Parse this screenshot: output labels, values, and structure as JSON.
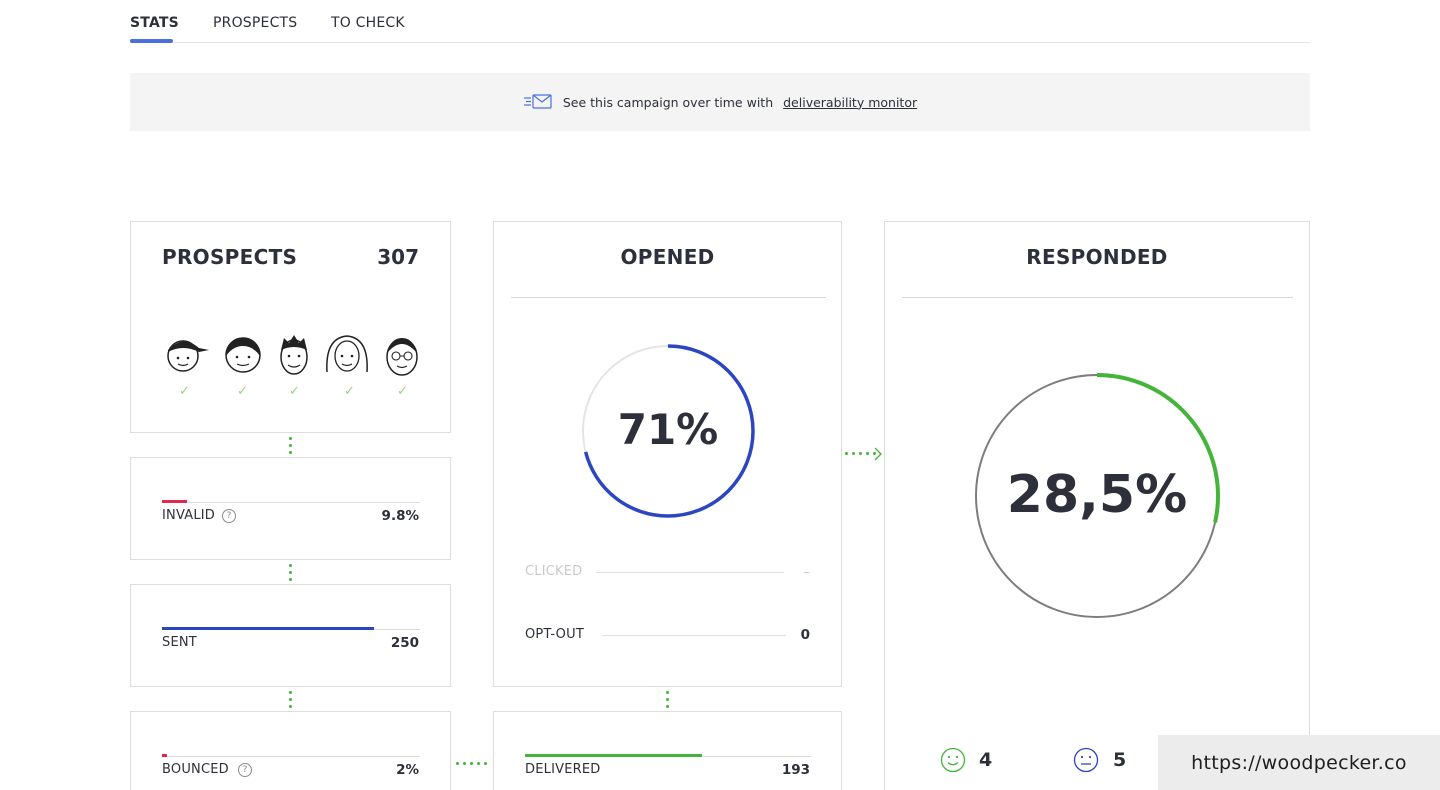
{
  "tabs": [
    {
      "label": "STATS",
      "active": true
    },
    {
      "label": "PROSPECTS",
      "active": false
    },
    {
      "label": "TO CHECK",
      "active": false
    }
  ],
  "banner": {
    "text": "See this campaign over time with",
    "link": "deliverability monitor",
    "icon": "mail-speed-icon"
  },
  "prospects": {
    "title": "PROSPECTS",
    "count": "307",
    "checks": [
      "✓",
      "✓",
      "✓",
      "✓",
      "✓"
    ]
  },
  "invalid": {
    "label": "INVALID",
    "value": "9.8%",
    "fraction": 0.098,
    "color": "#e2264d"
  },
  "sent": {
    "label": "SENT",
    "value": "250",
    "fraction": 0.82,
    "color": "#2c46c0"
  },
  "bounced": {
    "label": "BOUNCED",
    "value": "2%",
    "fraction": 0.02,
    "color": "#e2264d"
  },
  "opened": {
    "title": "OPENED",
    "percent_label": "71%",
    "fraction": 0.71,
    "color": "#2c46c0",
    "clicked": {
      "label": "CLICKED",
      "value": "–"
    },
    "opt_out": {
      "label": "OPT-OUT",
      "value": "0"
    }
  },
  "delivered": {
    "label": "DELIVERED",
    "value": "193",
    "fraction": 0.62,
    "color": "#45b43a"
  },
  "responded": {
    "title": "RESPONDED",
    "percent_label": "28,5%",
    "fraction": 0.285,
    "color": "#45b43a",
    "positive": {
      "value": "4",
      "icon": "smile-icon",
      "color": "#45b43a"
    },
    "neutral": {
      "value": "5",
      "icon": "neutral-face-icon",
      "color": "#2c46c0"
    }
  },
  "watermark": "https://woodpecker.co",
  "colors": {
    "accent": "#4a6fe0",
    "green": "#45b43a",
    "red": "#e2264d",
    "blue": "#2c46c0"
  }
}
